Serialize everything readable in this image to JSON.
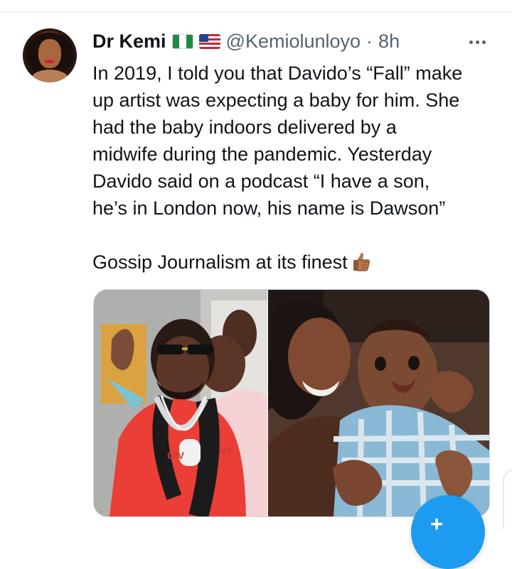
{
  "tweet": {
    "author_name": "Dr Kemi",
    "handle": "@Kemiolunloyo",
    "separator": "·",
    "time": "8h",
    "flags": [
      "nigeria-flag-icon",
      "us-flag-icon"
    ],
    "text_lines": [
      "In 2019, I told you that Davido’s “Fall” make",
      "up artist was expecting a baby for him. She",
      "had the baby indoors delivered by a",
      "midwife during the pandemic. Yesterday",
      "Davido said on a podcast “I have a son,",
      "he’s in London now, his name is Dawson”",
      "Gossip Journalism at its finest"
    ],
    "emoji": "thumbs-up-icon",
    "floating_action_icon": "+"
  },
  "colors": {
    "text_primary": "#0f1419",
    "text_secondary": "#536471",
    "accent": "#1d9bf0",
    "border": "#cfd9de"
  }
}
